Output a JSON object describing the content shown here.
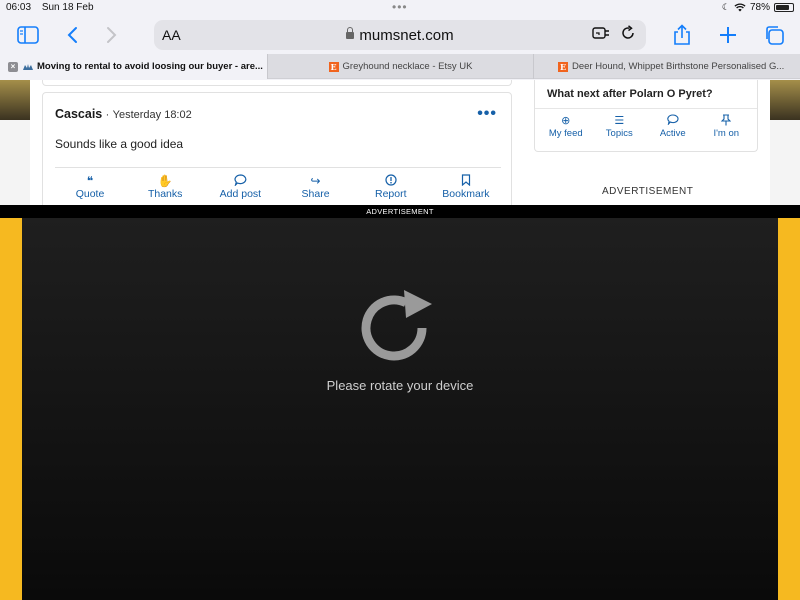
{
  "status_bar": {
    "time": "06:03",
    "date": "Sun 18 Feb",
    "battery": "78%"
  },
  "toolbar": {
    "text_size_label": "AA",
    "url": "mumsnet.com"
  },
  "tabs": [
    {
      "title": "Moving to rental to avoid loosing our buyer - are..."
    },
    {
      "title": "Greyhound necklace - Etsy UK",
      "favicon": "E"
    },
    {
      "title": "Deer Hound, Whippet Birthstone Personalised G...",
      "favicon": "E"
    }
  ],
  "post": {
    "author": "Cascais",
    "separator": "·",
    "timestamp": "Yesterday 18:02",
    "more_label": "•••",
    "body": "Sounds like a good idea",
    "actions": [
      {
        "label": "Quote",
        "icon": "quote-icon"
      },
      {
        "label": "Thanks",
        "icon": "thanks-icon"
      },
      {
        "label": "Add post",
        "icon": "speech-bubble-icon"
      },
      {
        "label": "Share",
        "icon": "share-arrow-icon"
      },
      {
        "label": "Report",
        "icon": "alert-icon"
      },
      {
        "label": "Bookmark",
        "icon": "bookmark-icon"
      }
    ]
  },
  "sidebar_panel": {
    "title": "What next after Polarn O Pyret?",
    "nav": [
      {
        "label": "My feed",
        "icon": "feed-icon"
      },
      {
        "label": "Topics",
        "icon": "list-icon"
      },
      {
        "label": "Active",
        "icon": "chat-icon"
      },
      {
        "label": "I'm on",
        "icon": "pin-icon"
      }
    ]
  },
  "advertisement_label": "ADVERTISEMENT",
  "overlay": {
    "strip_label": "ADVERTISEMENT",
    "message": "Please rotate your device"
  },
  "colors": {
    "accent": "#147efb",
    "link_blue": "#1660a8",
    "ad_frame": "#f6b920",
    "etsy_orange": "#f1641e"
  }
}
